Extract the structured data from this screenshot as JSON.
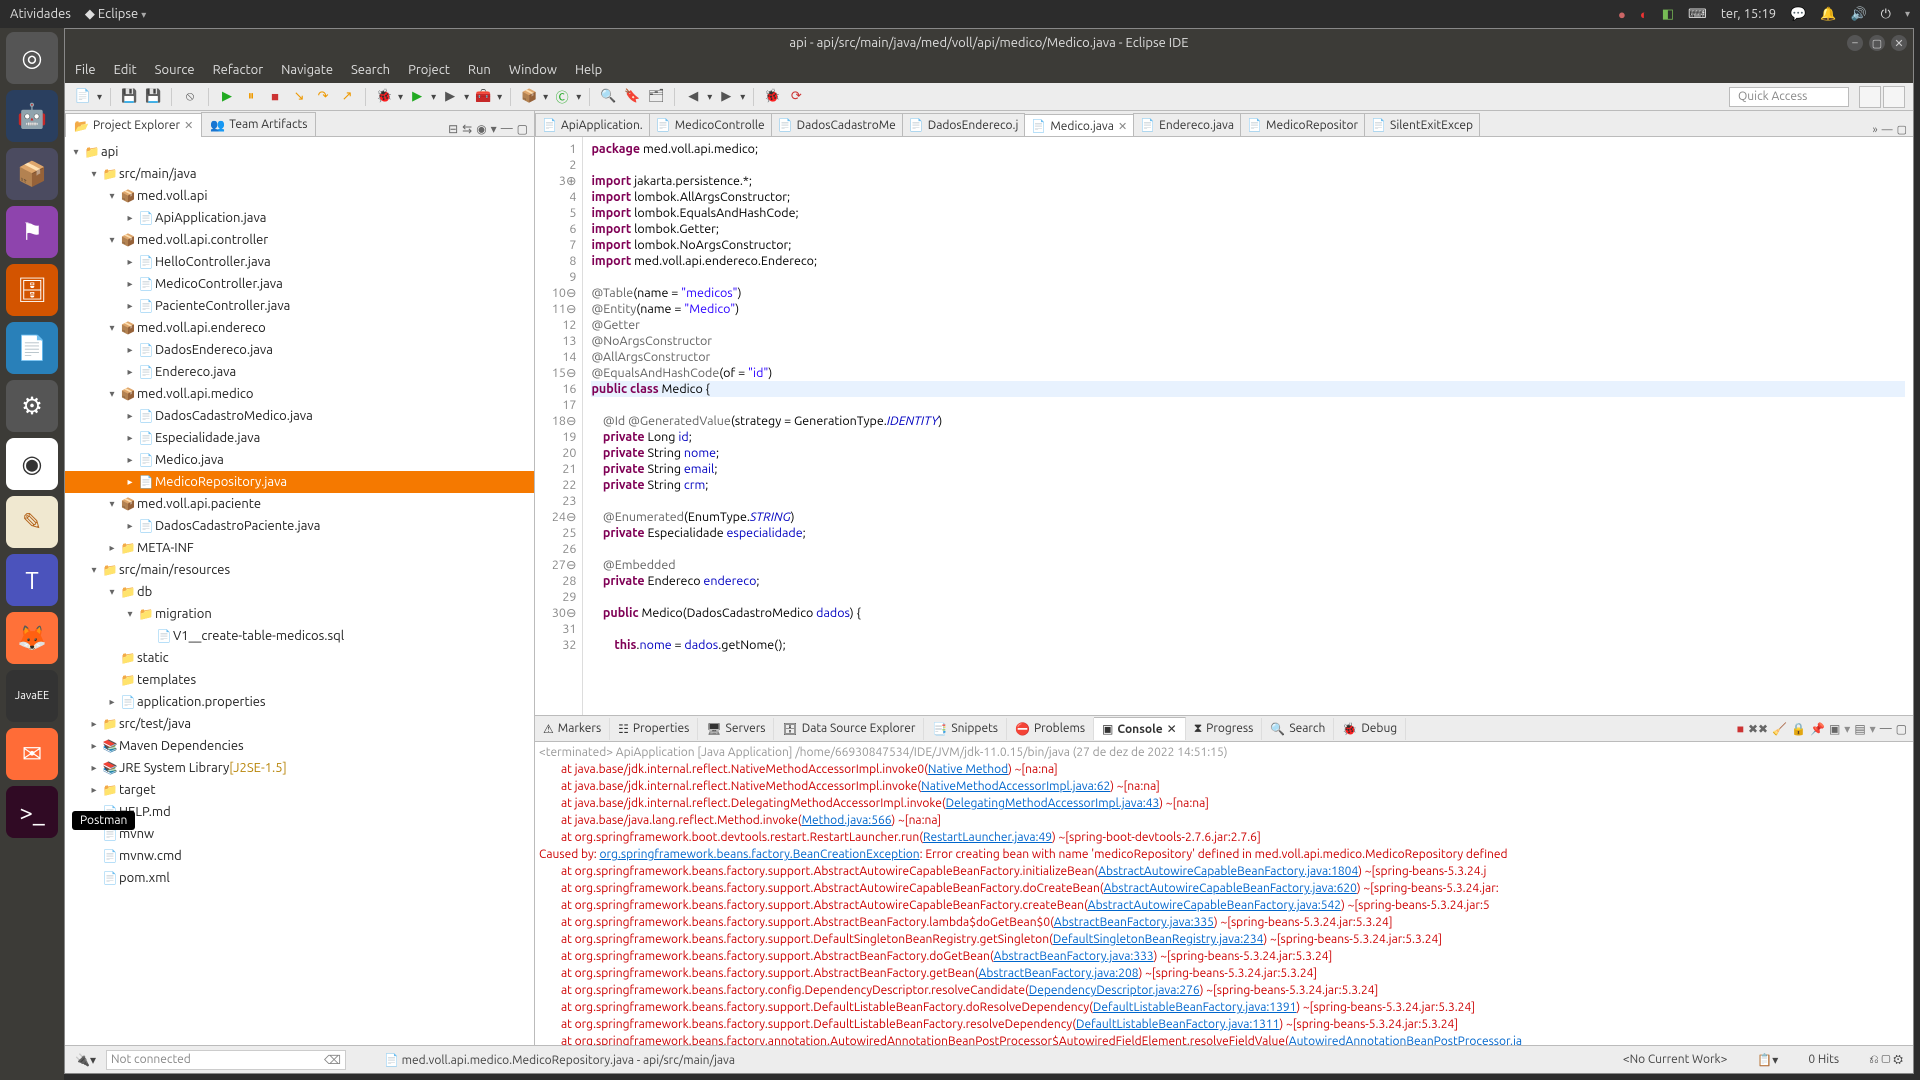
{
  "panel": {
    "atividades": "Atividades",
    "app": "Eclipse",
    "date": "ter, 15:19"
  },
  "window": {
    "title": "api - api/src/main/java/med/voll/api/medico/Medico.java - Eclipse IDE",
    "menus": [
      "File",
      "Edit",
      "Source",
      "Refactor",
      "Navigate",
      "Search",
      "Project",
      "Run",
      "Window",
      "Help"
    ],
    "quick_access": "Quick Access"
  },
  "project_explorer": {
    "tab": "Project Explorer",
    "team_artifacts": "Team Artifacts",
    "root": "api",
    "src_main": "src/main/java",
    "pkg_api": "med.voll.api",
    "api_app": "ApiApplication.java",
    "pkg_controller": "med.voll.api.controller",
    "hello": "HelloController.java",
    "medico_ctrl": "MedicoController.java",
    "paciente_ctrl": "PacienteController.java",
    "pkg_endereco": "med.voll.api.endereco",
    "dados_end": "DadosEndereco.java",
    "endereco": "Endereco.java",
    "pkg_medico": "med.voll.api.medico",
    "dados_cad": "DadosCadastroMedico.java",
    "espec": "Especialidade.java",
    "medico": "Medico.java",
    "medico_repo": "MedicoRepository.java",
    "pkg_paciente": "med.voll.api.paciente",
    "dados_pac": "DadosCadastroPaciente.java",
    "meta": "META-INF",
    "src_res": "src/main/resources",
    "db": "db",
    "migration": "migration",
    "v1": "V1__create-table-medicos.sql",
    "static": "static",
    "templates": "templates",
    "app_props": "application.properties",
    "src_test": "src/test/java",
    "maven_deps": "Maven Dependencies",
    "jre": "JRE System Library",
    "jre_ver": "[J2SE-1.5]",
    "target": "target",
    "help": "HELP.md",
    "mvnw": "mvnw",
    "mvnw_cmd": "mvnw.cmd",
    "pom": "pom.xml"
  },
  "editor_tabs": [
    "ApiApplication.",
    "MedicoControlle",
    "DadosCadastroMe",
    "DadosEndereco.j",
    "Medico.java",
    "Endereco.java",
    "MedicoRepositor",
    "SilentExitExcep"
  ],
  "editor_active": 4,
  "bottom_tabs": [
    "Markers",
    "Properties",
    "Servers",
    "Data Source Explorer",
    "Snippets",
    "Problems",
    "Console",
    "Progress",
    "Search",
    "Debug"
  ],
  "bottom_active": 6,
  "console_header": "<terminated> ApiApplication [Java Application] /home/66930847534/IDE/JVM/jdk-11.0.15/bin/java (27 de dez de 2022 14:51:15)",
  "status": {
    "not_connected": "Not connected",
    "path": "med.voll.api.medico.MedicoRepository.java - api/src/main/java",
    "work": "<No Current Work>",
    "hits": "0 Hits"
  },
  "tooltip": "Postman"
}
